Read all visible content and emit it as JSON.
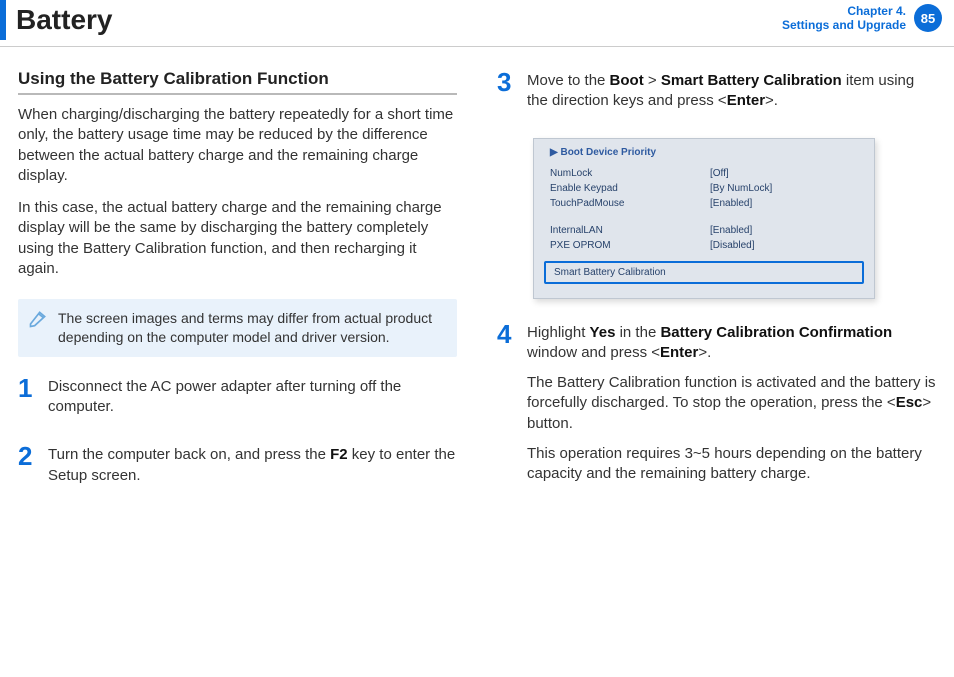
{
  "header": {
    "title": "Battery",
    "chapter_line1": "Chapter 4.",
    "chapter_line2": "Settings and Upgrade",
    "page_number": "85"
  },
  "left": {
    "heading": "Using the Battery Calibration Function",
    "p1": "When charging/discharging the battery repeatedly for a short time only, the battery usage time may be reduced by the difference between the actual battery charge and the remaining charge display.",
    "p2": "In this case, the actual battery charge and the remaining charge display will be the same by discharging the battery completely using the Battery Calibration function, and then recharging it again.",
    "note": "The screen images and terms may differ from actual product depending on the computer model and driver version.",
    "step1_num": "1",
    "step1": "Disconnect the AC power adapter after turning off the computer.",
    "step2_num": "2",
    "step2_a": "Turn the computer back on, and press the ",
    "step2_b": "F2",
    "step2_c": " key to enter the Setup screen."
  },
  "right": {
    "step3_num": "3",
    "step3_a": "Move to the ",
    "step3_b": "Boot",
    "step3_c": " > ",
    "step3_d": "Smart Battery Calibration",
    "step3_e": " item using the direction keys and press <",
    "step3_f": "Enter",
    "step3_g": ">.",
    "bios": {
      "header": "▶ Boot Device Priority",
      "rows1": [
        {
          "label": "NumLock",
          "value": "[Off]"
        },
        {
          "label": "Enable Keypad",
          "value": "[By NumLock]"
        },
        {
          "label": "TouchPadMouse",
          "value": "[Enabled]"
        }
      ],
      "rows2": [
        {
          "label": "InternalLAN",
          "value": "[Enabled]"
        },
        {
          "label": "PXE OPROM",
          "value": "[Disabled]"
        }
      ],
      "highlight": "Smart Battery Calibration"
    },
    "step4_num": "4",
    "step4_a": "Highlight ",
    "step4_b": "Yes",
    "step4_c": " in the ",
    "step4_d": "Battery Calibration Confirmation",
    "step4_e": " window and press <",
    "step4_f": "Enter",
    "step4_g": ">.",
    "step4_p2_a": "The Battery Calibration function is activated and the battery is forcefully discharged. To stop the operation, press the <",
    "step4_p2_b": "Esc",
    "step4_p2_c": "> button.",
    "step4_p3": "This operation requires 3~5 hours depending on the battery capacity and the remaining battery charge."
  }
}
